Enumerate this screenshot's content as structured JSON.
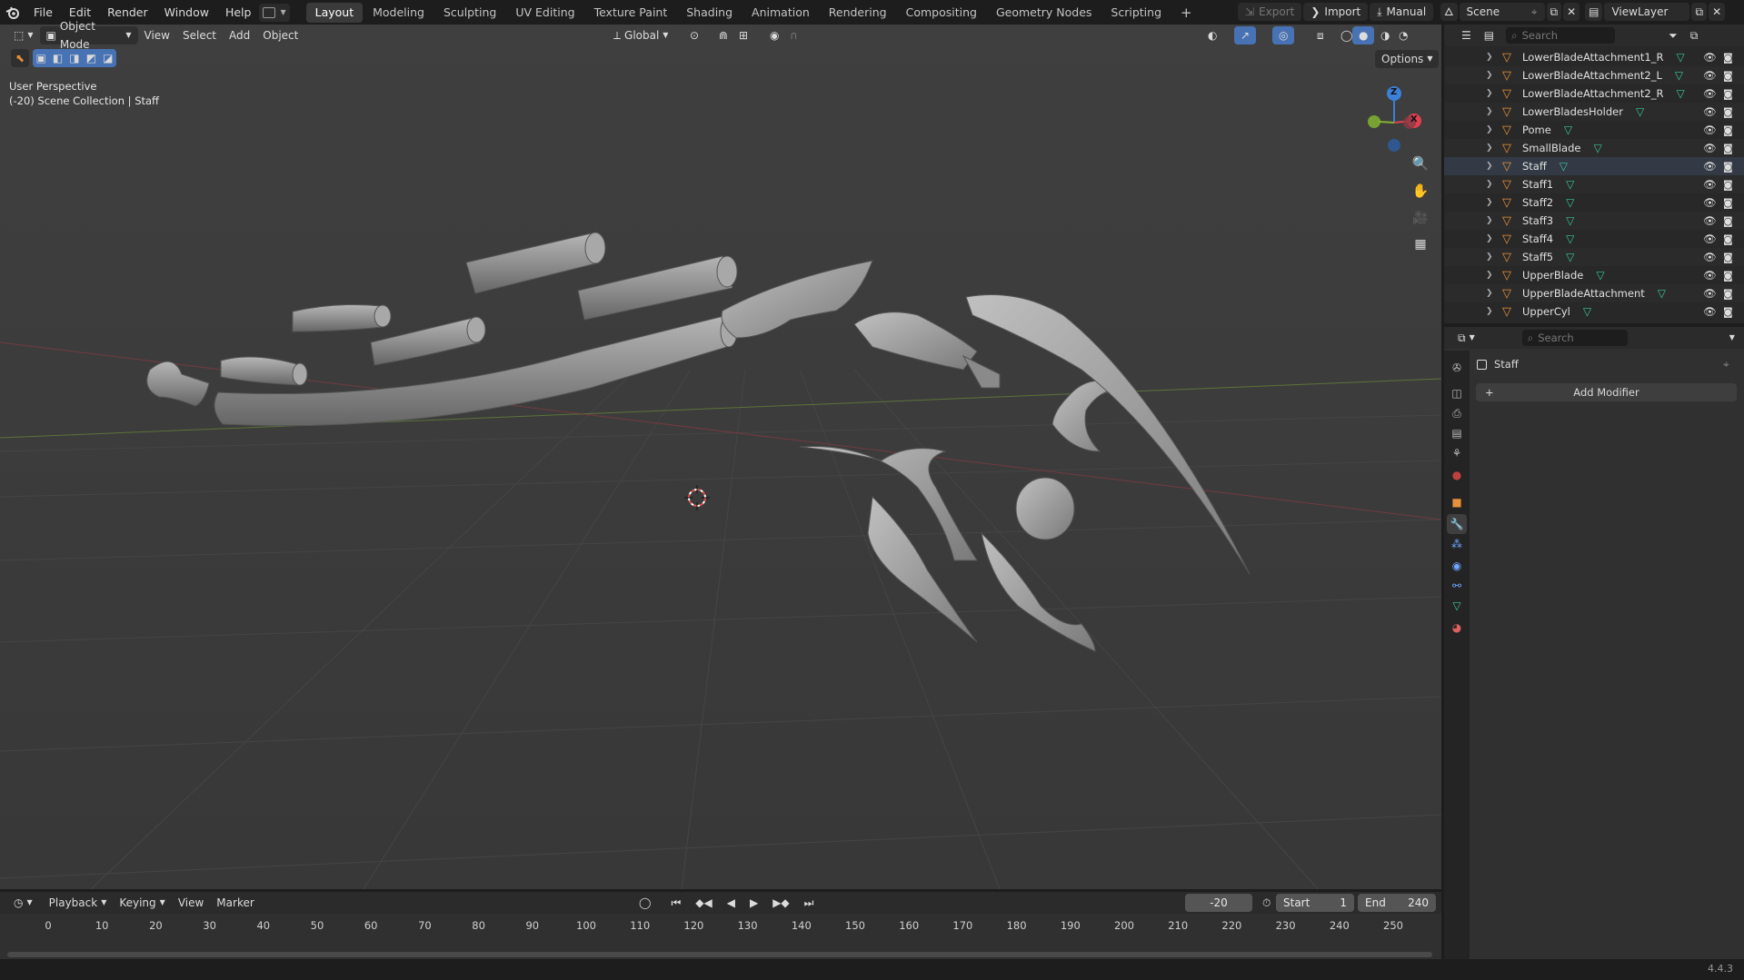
{
  "menubar": {
    "items": [
      "File",
      "Edit",
      "Render",
      "Window",
      "Help"
    ],
    "workspace_tabs": [
      "Layout",
      "Modeling",
      "Sculpting",
      "UV Editing",
      "Texture Paint",
      "Shading",
      "Animation",
      "Rendering",
      "Compositing",
      "Geometry Nodes",
      "Scripting"
    ],
    "active_tab": "Layout",
    "add_tab": "+",
    "export_label": "Export",
    "import_label": "Import",
    "manual_label": "Manual",
    "scene_name": "Scene",
    "view_layer": "ViewLayer"
  },
  "viewport_header": {
    "mode": "Object Mode",
    "menus": [
      "View",
      "Select",
      "Add",
      "Object"
    ],
    "orientation": "Global",
    "options_label": "Options"
  },
  "viewport": {
    "perspective_label": "User Perspective",
    "collection_label": "(-20) Scene Collection | Staff",
    "gizmo": {
      "z": "Z",
      "x": "X"
    }
  },
  "outliner": {
    "search_placeholder": "Search",
    "items": [
      {
        "name": "LowerBladeAttachment1_R",
        "selected": false
      },
      {
        "name": "LowerBladeAttachment2_L",
        "selected": false
      },
      {
        "name": "LowerBladeAttachment2_R",
        "selected": false
      },
      {
        "name": "LowerBladesHolder",
        "selected": false
      },
      {
        "name": "Pome",
        "selected": false
      },
      {
        "name": "SmallBlade",
        "selected": false
      },
      {
        "name": "Staff",
        "selected": true
      },
      {
        "name": "Staff1",
        "selected": false
      },
      {
        "name": "Staff2",
        "selected": false
      },
      {
        "name": "Staff3",
        "selected": false
      },
      {
        "name": "Staff4",
        "selected": false
      },
      {
        "name": "Staff5",
        "selected": false
      },
      {
        "name": "UpperBlade",
        "selected": false
      },
      {
        "name": "UpperBladeAttachment",
        "selected": false
      },
      {
        "name": "UpperCyl",
        "selected": false
      }
    ]
  },
  "properties": {
    "search_placeholder": "Search",
    "object_name": "Staff",
    "add_modifier_label": "Add Modifier",
    "active_tab": "modifier"
  },
  "timeline": {
    "menus": [
      "Playback",
      "Keying",
      "View",
      "Marker"
    ],
    "current_frame": "-20",
    "start_label": "Start",
    "start_value": "1",
    "end_label": "End",
    "end_value": "240",
    "ruler": [
      "0",
      "10",
      "20",
      "30",
      "40",
      "50",
      "60",
      "70",
      "80",
      "90",
      "100",
      "110",
      "120",
      "130",
      "140",
      "150",
      "160",
      "170",
      "180",
      "190",
      "200",
      "210",
      "220",
      "230",
      "240",
      "250"
    ]
  },
  "statusbar": {
    "version": "4.4.3"
  },
  "colors": {
    "accent_blue": "#4772b3",
    "mesh_orange": "#e8913a",
    "data_green": "#37c69b",
    "axis_x": "#e04050",
    "axis_y": "#83b332",
    "axis_z": "#3c7fd8"
  }
}
